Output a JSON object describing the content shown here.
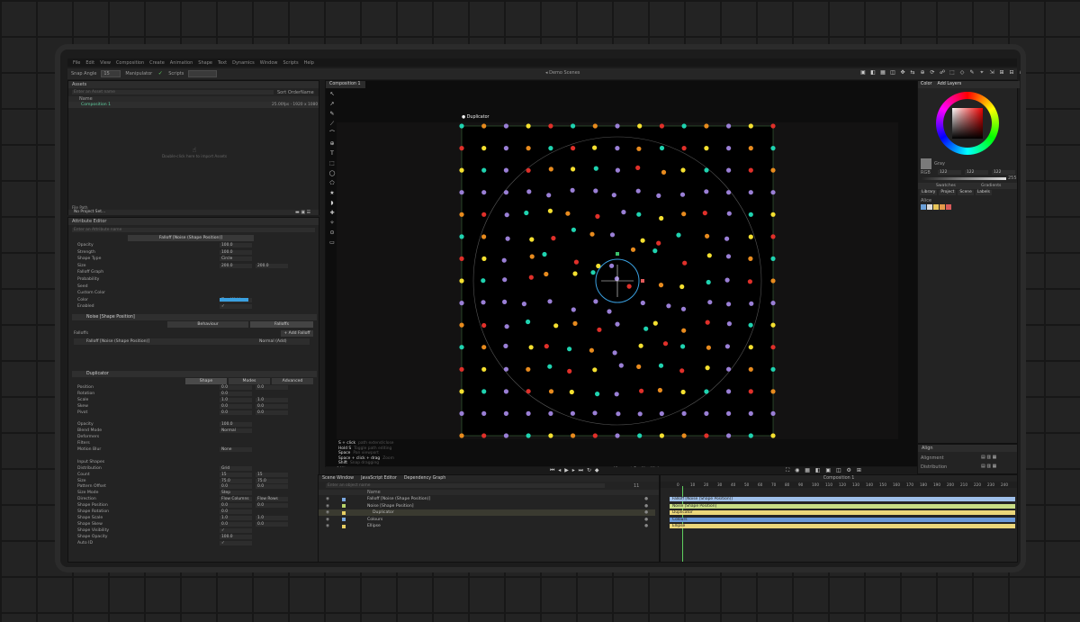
{
  "menu": [
    "File",
    "Edit",
    "View",
    "Composition",
    "Create",
    "Animation",
    "Shape",
    "Text",
    "Dynamics",
    "Window",
    "Scripts",
    "Help"
  ],
  "toolbar": {
    "snap_label": "Snap Angle",
    "snap_value": "15",
    "manipulator_label": "Manipulator",
    "scripts_label": "Scripts",
    "demo_scenes": "Demo Scenes",
    "search_placeholder": "Enter Search Term"
  },
  "assets": {
    "title": "Assets",
    "search_placeholder": "Enter an Asset name",
    "sort_label": "Sort Order",
    "sort_value": "Name",
    "column_name": "Name",
    "item_name": "Composition 1",
    "item_info": "25.00fps · 1920 x 1080",
    "empty_hint": "Double-click here to import Assets",
    "path_label": "File Path",
    "project_set": "No Project Set..."
  },
  "attribute_editor": {
    "title": "Attribute Editor",
    "search_placeholder": "Enter an Attribute name",
    "falloff_header": "Falloff [Noise (Shape Position)]",
    "falloff_rows": [
      {
        "label": "Opacity",
        "value": "100.0"
      },
      {
        "label": "Strength",
        "value": "100.0"
      },
      {
        "label": "Shape Type",
        "value": "Circle"
      },
      {
        "label": "Size",
        "value": "200.0",
        "value2": "200.0"
      },
      {
        "label": "Falloff Graph",
        "value": ""
      },
      {
        "label": "Probability",
        "value": ""
      },
      {
        "label": "Seed",
        "value": ""
      },
      {
        "label": "Custom Color",
        "value": ""
      },
      {
        "label": "Color",
        "value": "ZeroWidth"
      },
      {
        "label": "Enabled",
        "value": "✓"
      }
    ],
    "noise_header": "Noise [Shape Position]",
    "noise_tabs": [
      "Behaviour",
      "Falloffs"
    ],
    "falloffs_label": "Falloffs",
    "add_falloff": "+ Add Falloff",
    "falloff_item": "Falloff [Noise (Shape Position)]",
    "falloff_mode": "Normal (Add)",
    "duplicator_header": "Duplicator",
    "duplicator_tabs": [
      "Shape",
      "Modes",
      "Advanced"
    ],
    "duplicator_rows": [
      {
        "label": "Position",
        "value": "0.0",
        "value2": "0.0"
      },
      {
        "label": "Rotation",
        "value": "0.0",
        "value2": ""
      },
      {
        "label": "Scale",
        "value": "1.0",
        "value2": "1.0"
      },
      {
        "label": "Skew",
        "value": "0.0",
        "value2": "0.0"
      },
      {
        "label": "Pivot",
        "value": "0.0",
        "value2": "0.0"
      },
      {
        "label": "",
        "value": "",
        "value2": ""
      },
      {
        "label": "Opacity",
        "value": "100.0",
        "value2": ""
      },
      {
        "label": "Blend Mode",
        "value": "Normal",
        "value2": ""
      },
      {
        "label": "Deformers",
        "value": "",
        "value2": ""
      },
      {
        "label": "Filters",
        "value": "",
        "value2": ""
      },
      {
        "label": "Motion Blur",
        "value": "None",
        "value2": ""
      },
      {
        "label": "",
        "value": "",
        "value2": ""
      },
      {
        "label": "Input Shapes",
        "value": "",
        "value2": ""
      },
      {
        "label": "Distribution",
        "value": "Grid",
        "value2": ""
      },
      {
        "label": "Count",
        "value": "15",
        "value2": "15"
      },
      {
        "label": "Size",
        "value": "75.0",
        "value2": "75.0"
      },
      {
        "label": "Pattern Offset",
        "value": "0.0",
        "value2": "0.0"
      },
      {
        "label": "Size Mode",
        "value": "Step",
        "value2": ""
      },
      {
        "label": "Direction",
        "value": "Flow Columns",
        "value2": "Flow Rows"
      },
      {
        "label": "Shape Position",
        "value": "0.0",
        "value2": "0.0"
      },
      {
        "label": "Shape Rotation",
        "value": "0.0",
        "value2": ""
      },
      {
        "label": "Shape Scale",
        "value": "1.0",
        "value2": "1.0"
      },
      {
        "label": "Shape Skew",
        "value": "0.0",
        "value2": "0.0"
      },
      {
        "label": "Shape Visibility",
        "value": "✓",
        "value2": ""
      },
      {
        "label": "Shape Opacity",
        "value": "100.0",
        "value2": ""
      },
      {
        "label": "Auto ID",
        "value": "✓",
        "value2": ""
      }
    ]
  },
  "viewport": {
    "tab": "Composition 1",
    "duplicator_label": "Duplicator",
    "zoom": "94%",
    "quality": "Viewport Quality: High",
    "hints": [
      {
        "key": "S + click",
        "desc": "path extend/close"
      },
      {
        "key": "Hold S",
        "desc": "Toggle path editing"
      },
      {
        "key": "Space",
        "desc": "Pan viewport"
      },
      {
        "key": "Space + click + drag",
        "desc": "Zoom"
      },
      {
        "key": "Shift",
        "desc": "Snap dragging"
      }
    ]
  },
  "timeline": {
    "tabs": [
      "Scene Window",
      "JavaScript Editor",
      "Dependency Graph"
    ],
    "search_placeholder": "Enter an object name",
    "column_name": "Name",
    "frame_value": "11",
    "comp_label": "Composition 1",
    "ruler": [
      "0",
      "10",
      "20",
      "30",
      "40",
      "50",
      "60",
      "70",
      "80",
      "90",
      "100",
      "110",
      "120",
      "130",
      "140",
      "150",
      "160",
      "170",
      "180",
      "190",
      "200",
      "210",
      "220",
      "230",
      "240"
    ],
    "layers": [
      {
        "name": "Falloff [Noise (Shape Position)]",
        "color": "#7aa7e0",
        "track": "#9fc0ea",
        "track_label": "Falloff [Noise (Shape Position)]"
      },
      {
        "name": "Noise [Shape Position]",
        "color": "#b8d46a",
        "track": "#c9dd85",
        "track_label": "Noise [Shape Position]"
      },
      {
        "name": "Duplicator",
        "color": "#e8cf63",
        "track": "#ebd67a",
        "track_label": "Duplicator"
      },
      {
        "name": "Colours",
        "color": "#7aa7e0",
        "track": "#6a98d8",
        "track_label": "Colours"
      },
      {
        "name": "Ellipse",
        "color": "#e8cf63",
        "track": "#ebd67a",
        "track_label": "Ellipse"
      }
    ]
  },
  "color_panel": {
    "tabs": [
      "Color",
      "Add Layers"
    ],
    "swatch_name": "Gray",
    "mode": "RGB",
    "r": "122",
    "g": "122",
    "b": "122",
    "a": "255",
    "swatches_tabs": [
      "Swatches",
      "Gradients"
    ],
    "library_tabs": [
      "Library",
      "Project",
      "Scene",
      "Labels"
    ],
    "section": "Alice",
    "swatch_colors": [
      "#6a9fd8",
      "#d9d9d9",
      "#e8c55a",
      "#e39a4a",
      "#d85a5a"
    ]
  },
  "align_panel": {
    "title": "Align",
    "alignment_label": "Alignment",
    "distribution_label": "Distribution"
  },
  "dot_colors": [
    "#1fd3b0",
    "#f5e030",
    "#e88b1e",
    "#e0302a",
    "#9a7fd6"
  ]
}
